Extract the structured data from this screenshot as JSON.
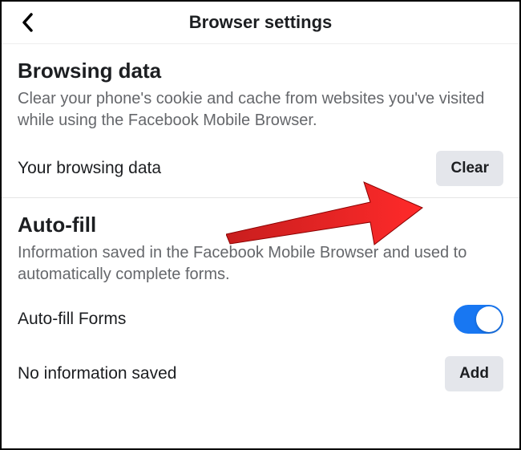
{
  "header": {
    "title": "Browser settings"
  },
  "browsing_data": {
    "title": "Browsing data",
    "description": "Clear your phone's cookie and cache from websites you've visited while using the Facebook Mobile Browser.",
    "row_label": "Your browsing data",
    "clear_label": "Clear"
  },
  "autofill": {
    "title": "Auto-fill",
    "description": "Information saved in the Facebook Mobile Browser and used to automatically complete forms.",
    "forms_label": "Auto-fill Forms",
    "forms_enabled": true,
    "no_info_label": "No information saved",
    "add_label": "Add"
  }
}
